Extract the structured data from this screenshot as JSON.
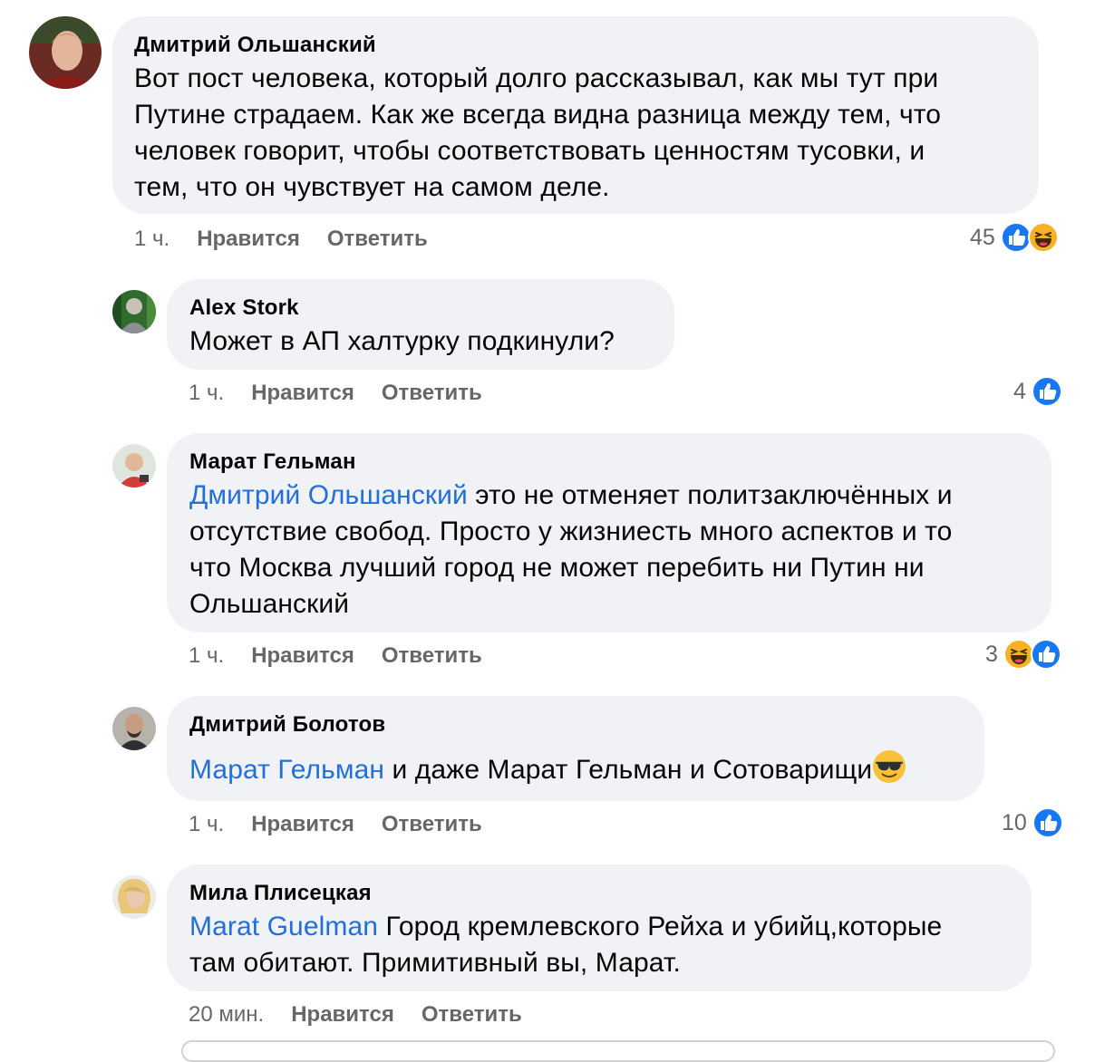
{
  "actions": {
    "like": "Нравится",
    "reply": "Ответить"
  },
  "colors": {
    "bubble": "#f0f2f5",
    "mention": "#216fdb",
    "meta": "#65676b",
    "like": "#1877f2",
    "haha": "#f7b125"
  },
  "comments": [
    {
      "author": "Дмитрий Ольшанский",
      "lines": [
        "Вот пост человека, который долго рассказывал, как мы тут при",
        "Путине страдаем. Как же всегда видна разница между тем, что",
        "человек говорит, чтобы соответствовать ценностям тусовки, и",
        "тем, что он чувствует на самом деле."
      ],
      "time": "1 ч.",
      "reaction_count": "45",
      "reaction_icons": [
        "like-icon",
        "haha-icon"
      ]
    },
    {
      "author": "Alex Stork",
      "lines": [
        "Может в АП халтурку подкинули?"
      ],
      "time": "1 ч.",
      "reaction_count": "4",
      "reaction_icons": [
        "like-icon"
      ]
    },
    {
      "author": "Марат Гельман",
      "mention": "Дмитрий Ольшанский",
      "lines": [
        " это не отменяет  политзаключённых и",
        "отсутствие свобод. Просто у жизниесть много аспектов и то",
        "что Москва лучший город не может перебить ни Путин ни",
        "Ольшанский"
      ],
      "time": "1 ч.",
      "reaction_count": "3",
      "reaction_icons": [
        "haha-icon",
        "like-icon"
      ]
    },
    {
      "author": "Дмитрий Болотов",
      "mention": "Марат Гельман",
      "lines": [
        " и даже Марат Гельман и Сотоварищи"
      ],
      "emoji": "sunglasses-emoji",
      "time": "1 ч.",
      "reaction_count": "10",
      "reaction_icons": [
        "like-icon"
      ]
    },
    {
      "author": "Мила Плисецкая",
      "mention": "Marat Guelman",
      "lines": [
        " Город кремлевского Рейха и убийц,которые",
        "там обитают. Примитивный вы, Марат."
      ],
      "time": "20 мин."
    }
  ]
}
